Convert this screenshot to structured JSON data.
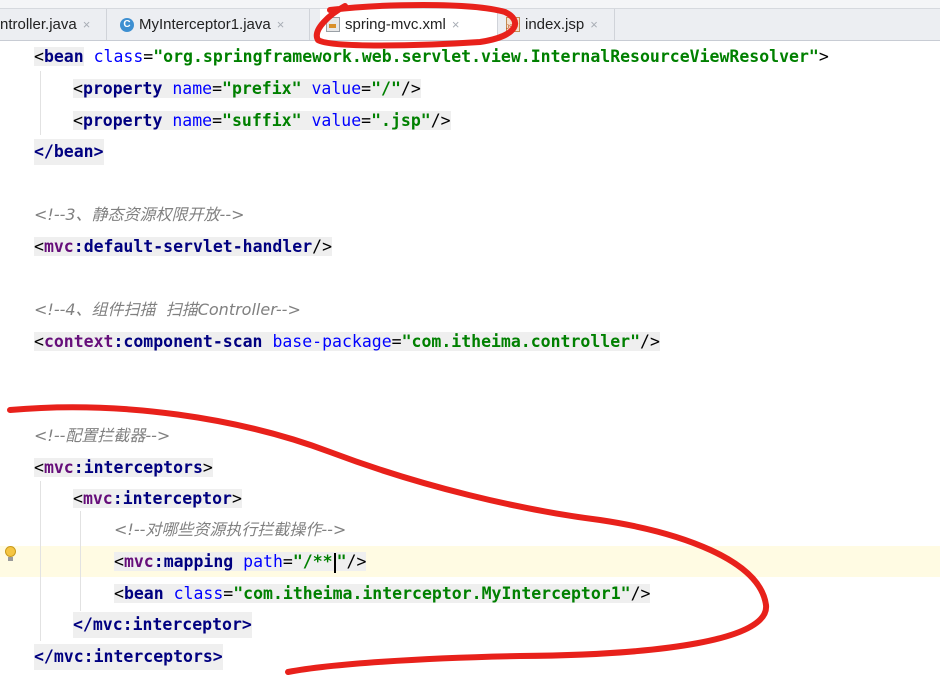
{
  "tabs": [
    {
      "label": "ntroller.java",
      "icon": "java-file-icon"
    },
    {
      "label": "MyInterceptor1.java",
      "icon": "class-file-icon"
    },
    {
      "label": "spring-mvc.xml",
      "icon": "xml-file-icon",
      "active": true
    },
    {
      "label": "index.jsp",
      "icon": "jsp-file-icon"
    }
  ],
  "close_glyph": "×",
  "code": {
    "bean_open": {
      "tag": "bean",
      "attr": "class",
      "value": "org.springframework.web.servlet.view.InternalResourceViewResolver"
    },
    "prop_prefix": {
      "tag": "property",
      "attr1": "name",
      "val1": "prefix",
      "attr2": "value",
      "val2": "/"
    },
    "prop_suffix": {
      "tag": "property",
      "attr1": "name",
      "val1": "suffix",
      "attr2": "value",
      "val2": ".jsp"
    },
    "bean_close": "</bean>",
    "comment3": "<!--3、静态资源权限开放-->",
    "default_servlet": {
      "ns": "mvc",
      "tag": "default-servlet-handler"
    },
    "comment4": "<!--4、组件扫描  扫描Controller-->",
    "component_scan": {
      "ns": "context",
      "tag": "component-scan",
      "attr": "base-package",
      "value": "com.itheima.controller"
    },
    "comment_interceptor": "<!--配置拦截器-->",
    "interceptors_open": {
      "ns": "mvc",
      "tag": "interceptors"
    },
    "interceptor_open": {
      "ns": "mvc",
      "tag": "interceptor"
    },
    "comment_mapping": "<!--对哪些资源执行拦截操作-->",
    "mapping": {
      "ns": "mvc",
      "tag": "mapping",
      "attr": "path",
      "value": "/**"
    },
    "bean_interceptor": {
      "tag": "bean",
      "attr": "class",
      "value": "com.itheima.interceptor.MyInterceptor1"
    },
    "interceptor_close": "</mvc:interceptor>",
    "interceptors_close": "</mvc:interceptors>"
  },
  "colors": {
    "tag": "#000080",
    "namespace": "#660e7a",
    "attr": "#0000ff",
    "value": "#008000",
    "comment": "#808080",
    "annotation": "#e8211b",
    "current_line": "#fffbe3"
  }
}
